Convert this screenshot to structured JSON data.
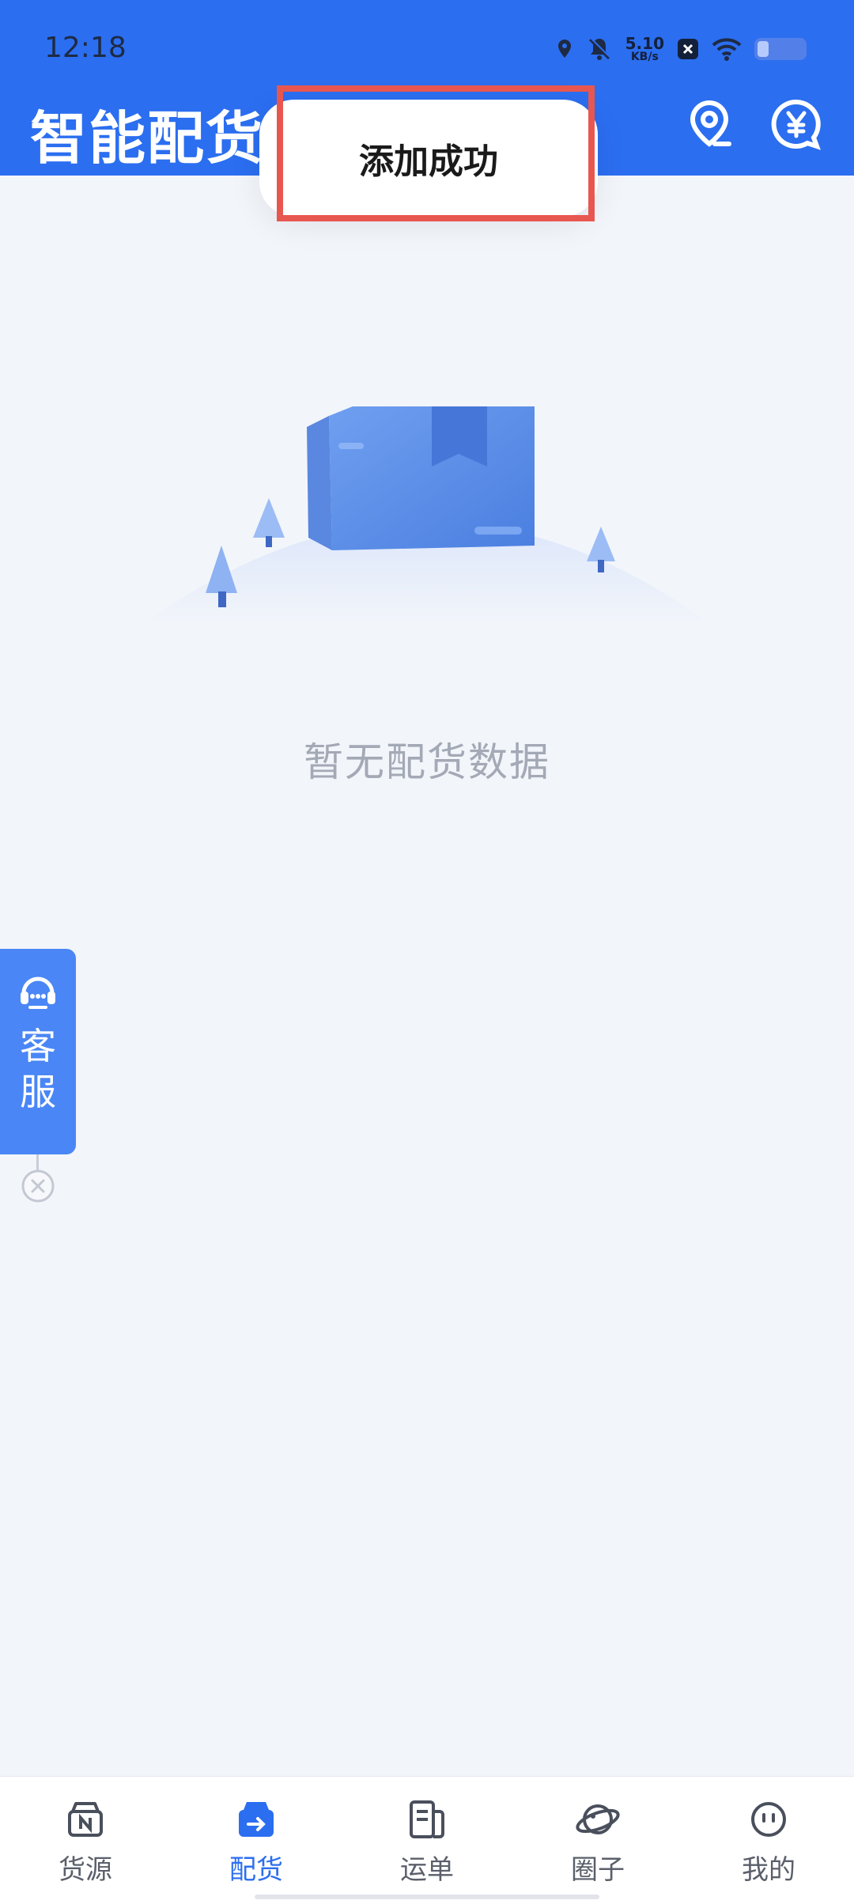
{
  "status_bar": {
    "time": "12:18",
    "net_speed_value": "5.10",
    "net_speed_unit": "KB/s",
    "icons": [
      "location-icon",
      "bell-off-icon",
      "x-app-icon",
      "wifi-icon",
      "battery-icon"
    ]
  },
  "header": {
    "title": "智能配货",
    "actions": [
      "location-pin-icon",
      "yen-chat-icon"
    ],
    "accent": "#2b6ef0"
  },
  "toast": {
    "text": "添加成功",
    "highlight_color": "#e8574f"
  },
  "empty_state": {
    "illustration": "box-on-hill-icon",
    "text": "暂无配货数据"
  },
  "customer_service": {
    "label": "客服",
    "icon": "headset-icon",
    "close_icon": "close-circle-icon"
  },
  "bottom_nav": {
    "items": [
      {
        "label": "货源",
        "icon": "cargo-icon",
        "active": false
      },
      {
        "label": "配货",
        "icon": "dispatch-icon",
        "active": true
      },
      {
        "label": "运单",
        "icon": "waybill-icon",
        "active": false
      },
      {
        "label": "圈子",
        "icon": "planet-icon",
        "active": false
      },
      {
        "label": "我的",
        "icon": "face-icon",
        "active": false
      }
    ]
  }
}
